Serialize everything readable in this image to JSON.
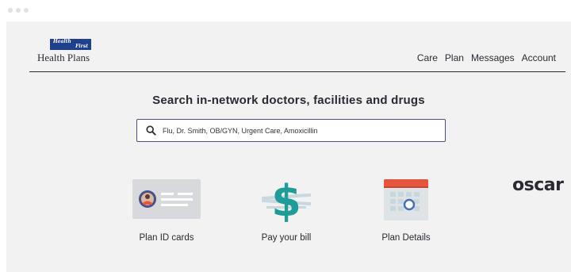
{
  "window": {
    "dots": [
      "dot-1",
      "dot-2",
      "dot-3"
    ]
  },
  "brand": {
    "badge_line1": "Health",
    "badge_line2": "First",
    "name": "Health Plans",
    "brand_color": "#1f3f8f"
  },
  "nav": {
    "items": [
      "Care",
      "Plan",
      "Messages",
      "Account"
    ]
  },
  "search": {
    "title": "Search in-network doctors, facilities and drugs",
    "placeholder": "Flu, Dr. Smith, OB/GYN, Urgent Care, Amoxicillin",
    "icon": "search-icon"
  },
  "tiles": [
    {
      "label": "Plan ID cards",
      "icon": "id-card-icon"
    },
    {
      "label": "Pay your bill",
      "icon": "dollar-icon"
    },
    {
      "label": "Plan Details",
      "icon": "calendar-icon"
    }
  ],
  "partner": {
    "name": "oscar"
  },
  "colors": {
    "background": "#f2f2f3",
    "text": "#2a2a33",
    "search_border": "#4a4f8a",
    "accent_red": "#e5563f",
    "accent_teal": "#1e9c98"
  }
}
